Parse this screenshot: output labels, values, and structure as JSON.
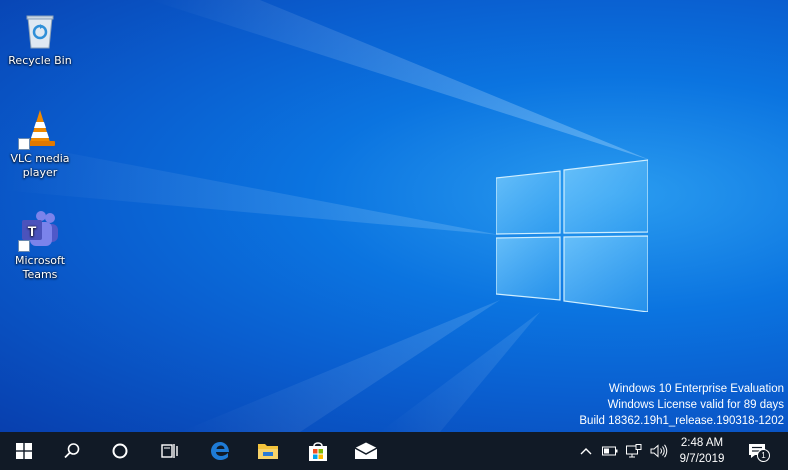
{
  "desktop": {
    "icons": [
      {
        "label": "Recycle Bin",
        "icon": "recycle-bin-icon"
      },
      {
        "label": "VLC media player",
        "icon": "vlc-icon",
        "shortcut": true
      },
      {
        "label": "Microsoft Teams",
        "icon": "teams-icon",
        "shortcut": true
      }
    ],
    "watermark": {
      "line1": "Windows 10 Enterprise Evaluation",
      "line2": "Windows License valid for 89 days",
      "line3": "Build 18362.19h1_release.190318-1202"
    },
    "wallpaper_colors": {
      "deep": "#083fae",
      "mid": "#0b74e0",
      "bright": "#2a9cf0"
    }
  },
  "taskbar": {
    "buttons": [
      {
        "name": "start",
        "icon": "windows-start-icon"
      },
      {
        "name": "search",
        "icon": "search-icon"
      },
      {
        "name": "cortana",
        "icon": "cortana-circle-icon"
      },
      {
        "name": "task-view",
        "icon": "task-view-icon"
      },
      {
        "name": "edge",
        "icon": "edge-icon"
      },
      {
        "name": "file-explorer",
        "icon": "folder-icon"
      },
      {
        "name": "store",
        "icon": "store-bag-icon"
      },
      {
        "name": "mail",
        "icon": "mail-icon"
      }
    ],
    "tray": {
      "chevron": "chevron-up-icon",
      "battery": "battery-icon",
      "network": "network-icon",
      "volume": "volume-icon"
    },
    "clock": {
      "time": "2:48 AM",
      "date": "9/7/2019"
    },
    "notifications": {
      "icon": "action-center-icon",
      "count": "1"
    },
    "colors": {
      "background": "#111a26",
      "edge_blue": "#1e7bd6",
      "folder_yellow": "#f3c33b"
    }
  }
}
